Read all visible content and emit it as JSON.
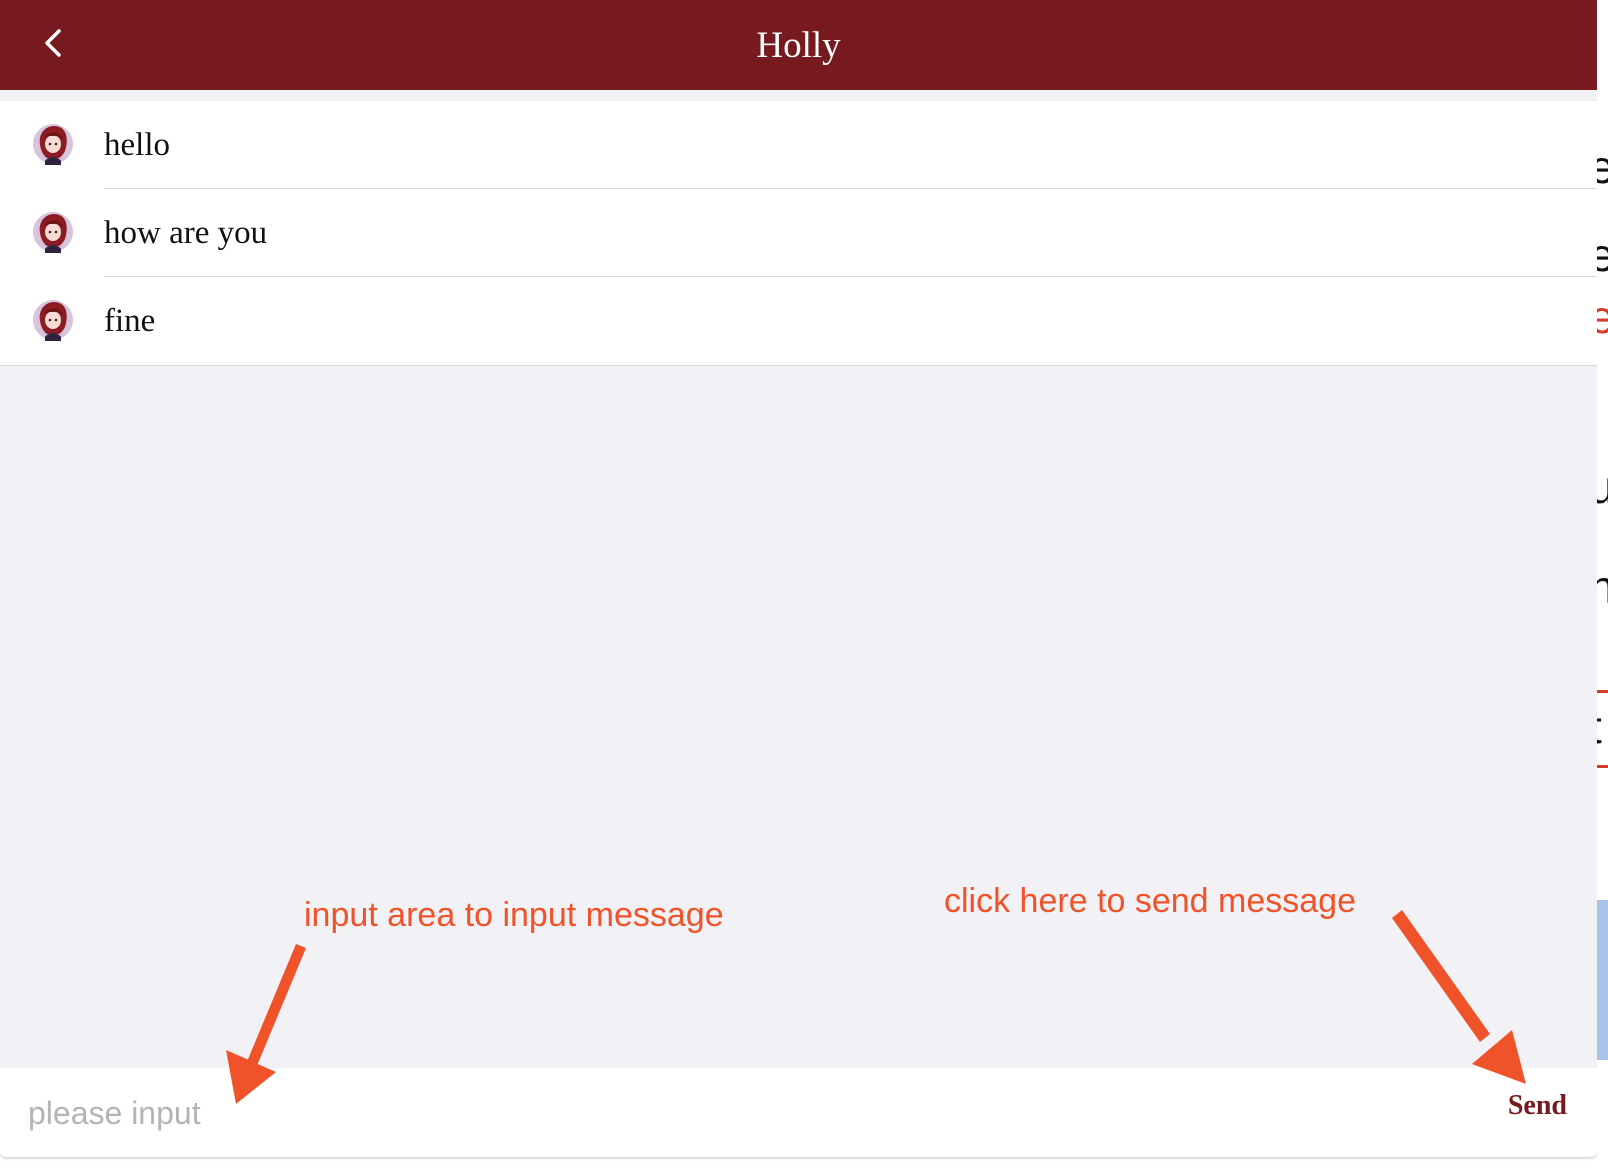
{
  "header": {
    "title": "Holly",
    "back_icon": "chevron-left-icon",
    "background_color": "#761a20"
  },
  "messages": [
    {
      "text": "hello",
      "avatar_icon": "user-avatar-icon"
    },
    {
      "text": "how are you",
      "avatar_icon": "user-avatar-icon"
    },
    {
      "text": "fine",
      "avatar_icon": "user-avatar-icon"
    }
  ],
  "composer": {
    "placeholder": "please input",
    "value": "",
    "send_label": "Send"
  },
  "annotations": {
    "input_hint": "input area to input message",
    "send_hint": "click here to send message",
    "color": "#f0532a"
  }
}
